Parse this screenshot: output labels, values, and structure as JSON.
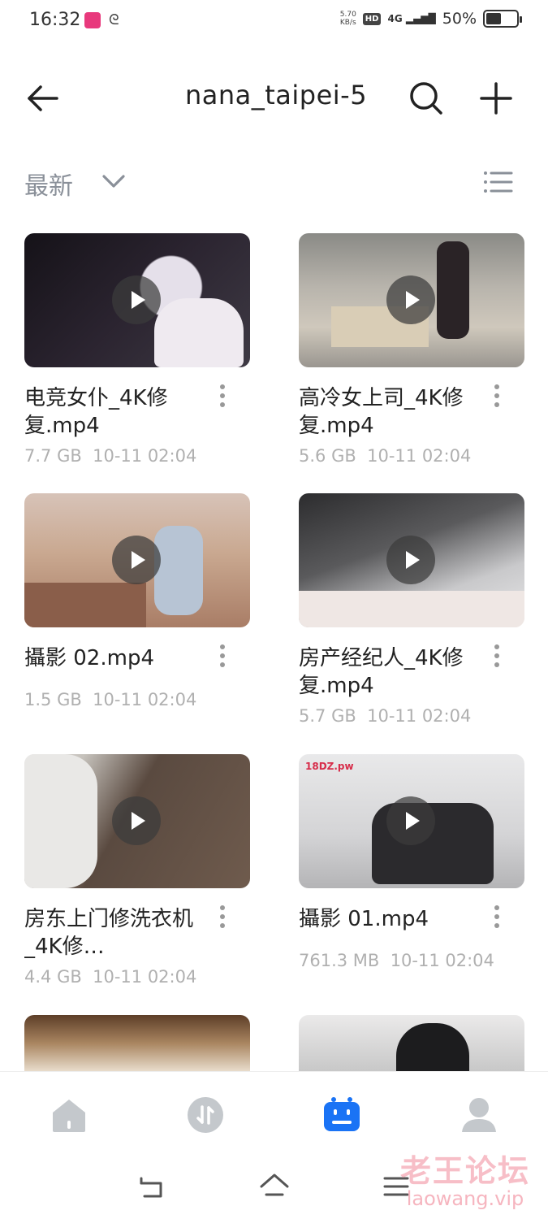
{
  "status_bar": {
    "time": "16:32",
    "net_speed_value": "5.70",
    "net_speed_unit": "KB/s",
    "hd_badge": "HD",
    "network": "4G",
    "battery_percent": "50%",
    "battery_level": 0.5
  },
  "header": {
    "title": "nana_taipei-5",
    "back_icon": "arrow-left-icon",
    "search_icon": "search-icon",
    "add_icon": "plus-icon"
  },
  "sort": {
    "label": "最新",
    "chevron_icon": "chevron-down-icon",
    "view_icon": "list-view-icon"
  },
  "files": [
    {
      "name": "电竞女仆_4K修复.mp4",
      "size": "7.7 GB",
      "date": "10-11 02:04"
    },
    {
      "name": "高冷女上司_4K修复.mp4",
      "size": "5.6 GB",
      "date": "10-11 02:04"
    },
    {
      "name": "攝影 02.mp4",
      "size": "1.5 GB",
      "date": "10-11 02:04"
    },
    {
      "name": "房产经纪人_4K修复.mp4",
      "size": "5.7 GB",
      "date": "10-11 02:04"
    },
    {
      "name": "房东上门修洗衣机_4K修…",
      "size": "4.4 GB",
      "date": "10-11 02:04"
    },
    {
      "name": "攝影 01.mp4",
      "size": "761.3 MB",
      "date": "10-11 02:04"
    }
  ],
  "thumb_text": {
    "t6_label": "18DZ.pw"
  },
  "bottom_nav": {
    "items": [
      {
        "icon": "home-icon"
      },
      {
        "icon": "transfer-icon"
      },
      {
        "icon": "files-icon",
        "active": true
      },
      {
        "icon": "profile-icon"
      }
    ],
    "active_color": "#1a73f5",
    "inactive_color": "#c4c8cc"
  },
  "watermark": {
    "line1": "老王论坛",
    "line2": "laowang.vip"
  }
}
